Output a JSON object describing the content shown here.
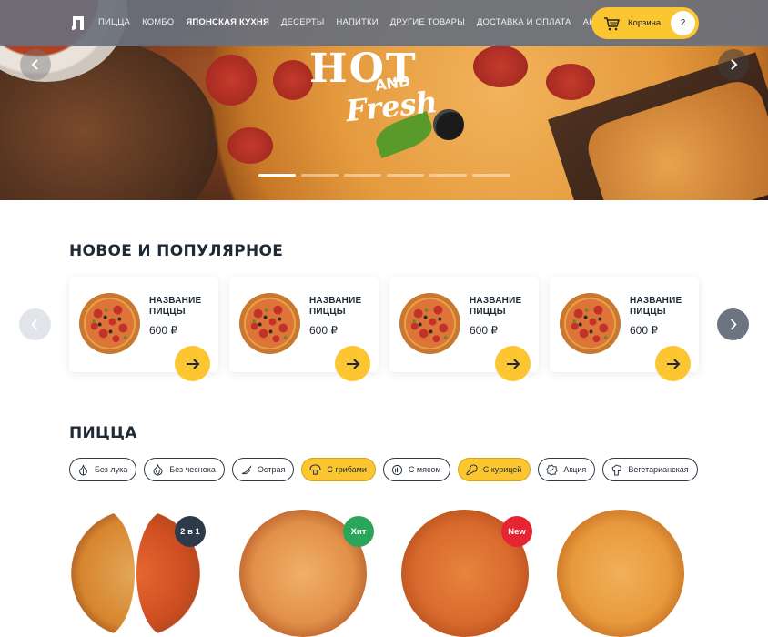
{
  "header": {
    "nav": [
      "ПИЦЦА",
      "КОМБО",
      "ЯПОНСКАЯ КУХНЯ",
      "ДЕСЕРТЫ",
      "НАПИТКИ",
      "ДРУГИЕ ТОВАРЫ",
      "ДОСТАВКА И ОПЛАТА",
      "АКЦИИ"
    ],
    "active_nav_index": 2,
    "cart_label": "Корзина",
    "cart_count": "2"
  },
  "hero": {
    "headline_line1": "HOT",
    "headline_line2": "AND",
    "headline_line3": "Fresh",
    "slide_count": 6,
    "active_slide": 1
  },
  "popular": {
    "title": "НОВОЕ И ПОПУЛЯРНОЕ",
    "items": [
      {
        "name": "НАЗВАНИЕ ПИЦЦЫ",
        "price": "600 ₽"
      },
      {
        "name": "НАЗВАНИЕ ПИЦЦЫ",
        "price": "600 ₽"
      },
      {
        "name": "НАЗВАНИЕ ПИЦЦЫ",
        "price": "600 ₽"
      },
      {
        "name": "НАЗВАНИЕ ПИЦЦЫ",
        "price": "600 ₽"
      }
    ]
  },
  "pizza": {
    "title": "ПИЦЦА",
    "filters": [
      {
        "label": "Без лука",
        "icon": "onion-icon",
        "selected": false
      },
      {
        "label": "Без чеснока",
        "icon": "garlic-icon",
        "selected": false
      },
      {
        "label": "Острая",
        "icon": "chili-icon",
        "selected": false
      },
      {
        "label": "С грибами",
        "icon": "mushroom-icon",
        "selected": true
      },
      {
        "label": "С мясом",
        "icon": "meat-icon",
        "selected": false
      },
      {
        "label": "С курицей",
        "icon": "chicken-icon",
        "selected": true
      },
      {
        "label": "Акция",
        "icon": "percent-icon",
        "selected": false
      },
      {
        "label": "Вегетарианская",
        "icon": "broccoli-icon",
        "selected": false
      }
    ],
    "badges": [
      "2 в 1",
      "Хит",
      "New"
    ]
  },
  "colors": {
    "accent": "#fbc630",
    "header_bg": "#69707c",
    "badge_dark": "#2c3a4a",
    "badge_green": "#2aa55a",
    "badge_red": "#e52531"
  }
}
